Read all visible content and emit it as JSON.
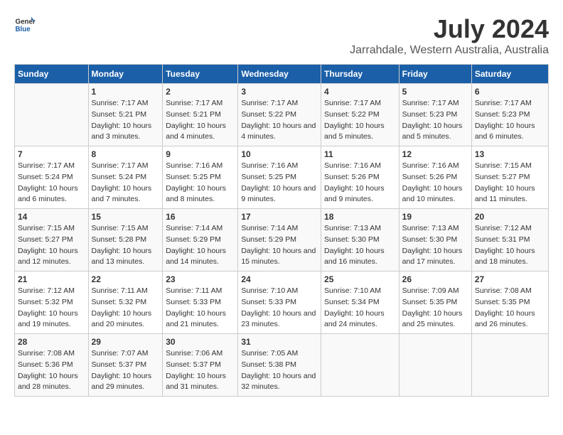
{
  "header": {
    "logo_line1": "General",
    "logo_line2": "Blue",
    "main_title": "July 2024",
    "subtitle": "Jarrahdale, Western Australia, Australia"
  },
  "columns": [
    "Sunday",
    "Monday",
    "Tuesday",
    "Wednesday",
    "Thursday",
    "Friday",
    "Saturday"
  ],
  "weeks": [
    [
      {
        "day": "",
        "sunrise": "",
        "sunset": "",
        "daylight": ""
      },
      {
        "day": "1",
        "sunrise": "Sunrise: 7:17 AM",
        "sunset": "Sunset: 5:21 PM",
        "daylight": "Daylight: 10 hours and 3 minutes."
      },
      {
        "day": "2",
        "sunrise": "Sunrise: 7:17 AM",
        "sunset": "Sunset: 5:21 PM",
        "daylight": "Daylight: 10 hours and 4 minutes."
      },
      {
        "day": "3",
        "sunrise": "Sunrise: 7:17 AM",
        "sunset": "Sunset: 5:22 PM",
        "daylight": "Daylight: 10 hours and 4 minutes."
      },
      {
        "day": "4",
        "sunrise": "Sunrise: 7:17 AM",
        "sunset": "Sunset: 5:22 PM",
        "daylight": "Daylight: 10 hours and 5 minutes."
      },
      {
        "day": "5",
        "sunrise": "Sunrise: 7:17 AM",
        "sunset": "Sunset: 5:23 PM",
        "daylight": "Daylight: 10 hours and 5 minutes."
      },
      {
        "day": "6",
        "sunrise": "Sunrise: 7:17 AM",
        "sunset": "Sunset: 5:23 PM",
        "daylight": "Daylight: 10 hours and 6 minutes."
      }
    ],
    [
      {
        "day": "7",
        "sunrise": "Sunrise: 7:17 AM",
        "sunset": "Sunset: 5:24 PM",
        "daylight": "Daylight: 10 hours and 6 minutes."
      },
      {
        "day": "8",
        "sunrise": "Sunrise: 7:17 AM",
        "sunset": "Sunset: 5:24 PM",
        "daylight": "Daylight: 10 hours and 7 minutes."
      },
      {
        "day": "9",
        "sunrise": "Sunrise: 7:16 AM",
        "sunset": "Sunset: 5:25 PM",
        "daylight": "Daylight: 10 hours and 8 minutes."
      },
      {
        "day": "10",
        "sunrise": "Sunrise: 7:16 AM",
        "sunset": "Sunset: 5:25 PM",
        "daylight": "Daylight: 10 hours and 9 minutes."
      },
      {
        "day": "11",
        "sunrise": "Sunrise: 7:16 AM",
        "sunset": "Sunset: 5:26 PM",
        "daylight": "Daylight: 10 hours and 9 minutes."
      },
      {
        "day": "12",
        "sunrise": "Sunrise: 7:16 AM",
        "sunset": "Sunset: 5:26 PM",
        "daylight": "Daylight: 10 hours and 10 minutes."
      },
      {
        "day": "13",
        "sunrise": "Sunrise: 7:15 AM",
        "sunset": "Sunset: 5:27 PM",
        "daylight": "Daylight: 10 hours and 11 minutes."
      }
    ],
    [
      {
        "day": "14",
        "sunrise": "Sunrise: 7:15 AM",
        "sunset": "Sunset: 5:27 PM",
        "daylight": "Daylight: 10 hours and 12 minutes."
      },
      {
        "day": "15",
        "sunrise": "Sunrise: 7:15 AM",
        "sunset": "Sunset: 5:28 PM",
        "daylight": "Daylight: 10 hours and 13 minutes."
      },
      {
        "day": "16",
        "sunrise": "Sunrise: 7:14 AM",
        "sunset": "Sunset: 5:29 PM",
        "daylight": "Daylight: 10 hours and 14 minutes."
      },
      {
        "day": "17",
        "sunrise": "Sunrise: 7:14 AM",
        "sunset": "Sunset: 5:29 PM",
        "daylight": "Daylight: 10 hours and 15 minutes."
      },
      {
        "day": "18",
        "sunrise": "Sunrise: 7:13 AM",
        "sunset": "Sunset: 5:30 PM",
        "daylight": "Daylight: 10 hours and 16 minutes."
      },
      {
        "day": "19",
        "sunrise": "Sunrise: 7:13 AM",
        "sunset": "Sunset: 5:30 PM",
        "daylight": "Daylight: 10 hours and 17 minutes."
      },
      {
        "day": "20",
        "sunrise": "Sunrise: 7:12 AM",
        "sunset": "Sunset: 5:31 PM",
        "daylight": "Daylight: 10 hours and 18 minutes."
      }
    ],
    [
      {
        "day": "21",
        "sunrise": "Sunrise: 7:12 AM",
        "sunset": "Sunset: 5:32 PM",
        "daylight": "Daylight: 10 hours and 19 minutes."
      },
      {
        "day": "22",
        "sunrise": "Sunrise: 7:11 AM",
        "sunset": "Sunset: 5:32 PM",
        "daylight": "Daylight: 10 hours and 20 minutes."
      },
      {
        "day": "23",
        "sunrise": "Sunrise: 7:11 AM",
        "sunset": "Sunset: 5:33 PM",
        "daylight": "Daylight: 10 hours and 21 minutes."
      },
      {
        "day": "24",
        "sunrise": "Sunrise: 7:10 AM",
        "sunset": "Sunset: 5:33 PM",
        "daylight": "Daylight: 10 hours and 23 minutes."
      },
      {
        "day": "25",
        "sunrise": "Sunrise: 7:10 AM",
        "sunset": "Sunset: 5:34 PM",
        "daylight": "Daylight: 10 hours and 24 minutes."
      },
      {
        "day": "26",
        "sunrise": "Sunrise: 7:09 AM",
        "sunset": "Sunset: 5:35 PM",
        "daylight": "Daylight: 10 hours and 25 minutes."
      },
      {
        "day": "27",
        "sunrise": "Sunrise: 7:08 AM",
        "sunset": "Sunset: 5:35 PM",
        "daylight": "Daylight: 10 hours and 26 minutes."
      }
    ],
    [
      {
        "day": "28",
        "sunrise": "Sunrise: 7:08 AM",
        "sunset": "Sunset: 5:36 PM",
        "daylight": "Daylight: 10 hours and 28 minutes."
      },
      {
        "day": "29",
        "sunrise": "Sunrise: 7:07 AM",
        "sunset": "Sunset: 5:37 PM",
        "daylight": "Daylight: 10 hours and 29 minutes."
      },
      {
        "day": "30",
        "sunrise": "Sunrise: 7:06 AM",
        "sunset": "Sunset: 5:37 PM",
        "daylight": "Daylight: 10 hours and 31 minutes."
      },
      {
        "day": "31",
        "sunrise": "Sunrise: 7:05 AM",
        "sunset": "Sunset: 5:38 PM",
        "daylight": "Daylight: 10 hours and 32 minutes."
      },
      {
        "day": "",
        "sunrise": "",
        "sunset": "",
        "daylight": ""
      },
      {
        "day": "",
        "sunrise": "",
        "sunset": "",
        "daylight": ""
      },
      {
        "day": "",
        "sunrise": "",
        "sunset": "",
        "daylight": ""
      }
    ]
  ]
}
